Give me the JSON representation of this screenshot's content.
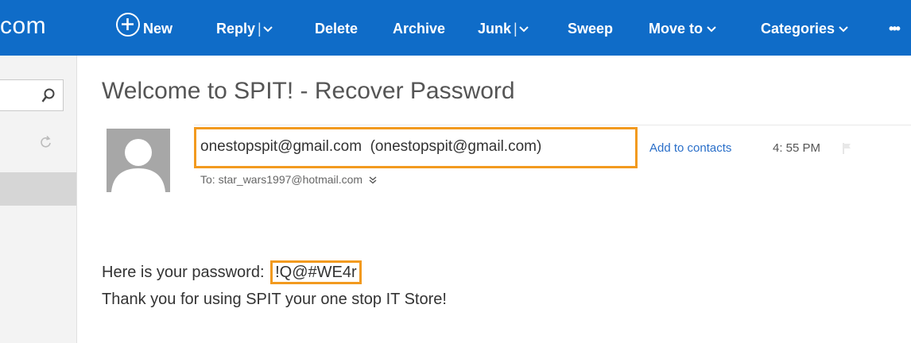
{
  "brand": {
    "label": "com"
  },
  "toolbar": {
    "items": [
      {
        "label": "New"
      },
      {
        "label": "Reply"
      },
      {
        "label": "Delete"
      },
      {
        "label": "Archive"
      },
      {
        "label": "Junk"
      },
      {
        "label": "Sweep"
      },
      {
        "label": "Move to"
      },
      {
        "label": "Categories"
      },
      {
        "label": "•••"
      }
    ]
  },
  "message": {
    "subject": "Welcome to SPIT! - Recover Password",
    "from": "onestopspit@gmail.com  (onestopspit@gmail.com)",
    "add_to_contacts": "Add to contacts",
    "time": "4: 55 PM",
    "to": "To: star_wars1997@hotmail.com",
    "body_prefix": "Here is your password: ",
    "password": "!Q@#WE4r",
    "body_line2": "Thank you for using SPIT your one stop IT Store!"
  },
  "colors": {
    "accent": "#0f6cc8",
    "highlight": "#f29a1f",
    "link": "#2a6fc9"
  },
  "icons": [
    "new-plus-icon",
    "chevron-down-icon",
    "search-icon",
    "refresh-icon",
    "flag-icon",
    "avatar-icon"
  ]
}
